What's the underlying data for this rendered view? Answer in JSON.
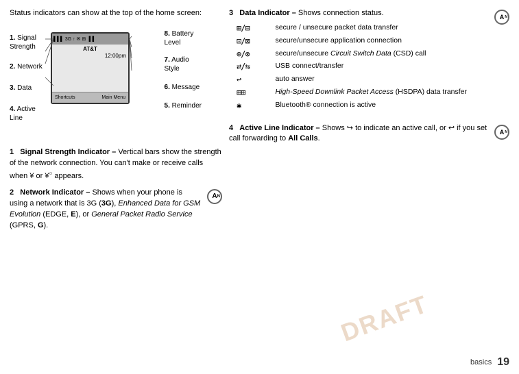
{
  "intro": {
    "text": "Status indicators can show at the top of the home screen:"
  },
  "labels": {
    "left": [
      {
        "num": "1.",
        "name": "Signal\nStrength"
      },
      {
        "num": "2.",
        "name": "Network"
      },
      {
        "num": "3.",
        "name": "Data"
      },
      {
        "num": "4.",
        "name": "Active\nLine"
      }
    ],
    "right": [
      {
        "num": "8.",
        "name": "Battery\nLevel"
      },
      {
        "num": "7.",
        "name": "Audio\nStyle"
      },
      {
        "num": "6.",
        "name": "Message"
      },
      {
        "num": "5.",
        "name": "Reminder"
      }
    ]
  },
  "phone": {
    "carrier": "AT&T",
    "time": "12:00pm",
    "shortcuts": "Shortcuts",
    "mainMenu": "Main Menu"
  },
  "sections": [
    {
      "num": "1",
      "title": "Signal Strength Indicator",
      "dash": "–",
      "body": " Vertical bars show the strength of the network connection. You can't make or receive calls when  or  appears.",
      "has_icon": false
    },
    {
      "num": "2",
      "title": "Network Indicator",
      "dash": "–",
      "body": " Shows when your phone is using a network that is 3G (3G), Enhanced Data for GSM Evolution (EDGE, E), or General Packet Radio Service (GPRS, G).",
      "has_icon": true
    }
  ],
  "right_sections": [
    {
      "num": "3",
      "title": "Data Indicator",
      "dash": "–",
      "body": " Shows connection status.",
      "has_icon": true,
      "indicators": [
        {
          "icon": "⊞/⊟",
          "desc": "secure / unsecure packet data transfer"
        },
        {
          "icon": "⊡/⊠",
          "desc": "secure/unsecure application connection"
        },
        {
          "icon": "⊕/⊗",
          "desc": "secure/unsecure Circuit Switch Data (CSD) call"
        },
        {
          "icon": "⇄/⇆",
          "desc": "USB connect/transfer"
        },
        {
          "icon": "↩",
          "desc": "auto answer"
        },
        {
          "icon": "⊞⊞",
          "desc": "High-Speed Downlink Packet Access (HSDPA) data transfer"
        },
        {
          "icon": "✱",
          "desc": "Bluetooth® connection is active"
        }
      ]
    },
    {
      "num": "4",
      "title": "Active Line Indicator",
      "dash": "–",
      "body": " Shows  to indicate an active call, or  if you set call forwarding to All Calls.",
      "has_icon": true
    }
  ],
  "footer": {
    "word": "basics",
    "page": "19"
  },
  "watermark": "DRAFT"
}
